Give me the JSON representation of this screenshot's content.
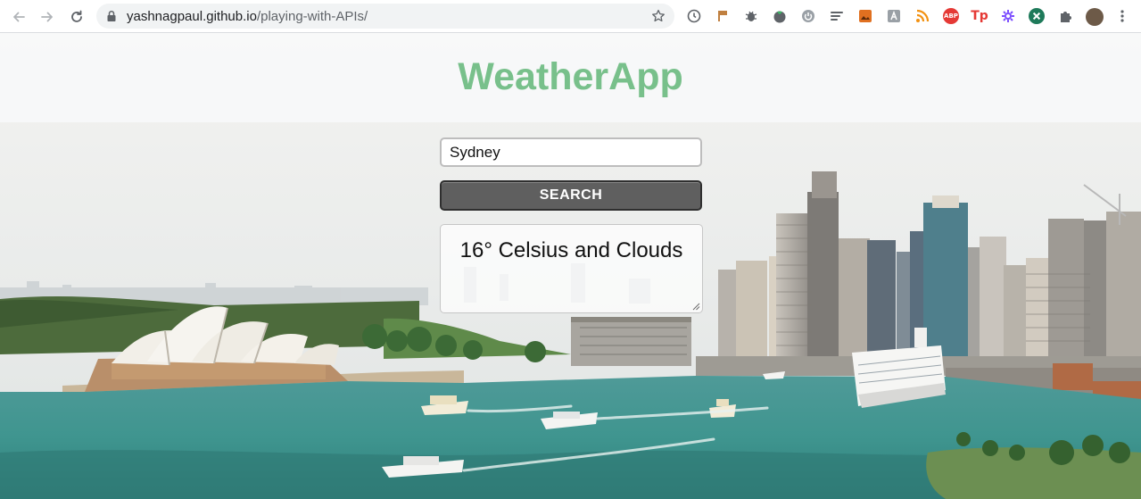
{
  "browser": {
    "url_host": "yashnagpaul.github.io",
    "url_path": "/playing-with-APIs/",
    "extensions": [
      {
        "icon": "timer-icon",
        "color": "#5f6368"
      },
      {
        "icon": "flag-icon",
        "color": "#c08040"
      },
      {
        "icon": "bug-icon",
        "color": "#5f6368"
      },
      {
        "icon": "tomato-icon",
        "color": "#5f6368"
      },
      {
        "icon": "power-icon",
        "color": "#9aa0a6"
      },
      {
        "icon": "list-icon",
        "color": "#5f6368"
      },
      {
        "icon": "picture-icon",
        "color": "#e07020"
      },
      {
        "icon": "translate-icon",
        "color": "#9aa0a6"
      },
      {
        "icon": "rss-icon",
        "color": "#f29111"
      },
      {
        "icon": "adblock-icon",
        "color": "#e53935",
        "label": "ABP"
      },
      {
        "icon": "tp-icon",
        "color": "#e53935",
        "label": "Tp"
      },
      {
        "icon": "gear-flower-icon",
        "color": "#7c4dff"
      },
      {
        "icon": "x-icon",
        "color": "#1e7a5a"
      },
      {
        "icon": "puzzle-icon",
        "color": "#5f6368"
      },
      {
        "icon": "profile-avatar",
        "color": "#6d5a48"
      },
      {
        "icon": "menu-dots-icon",
        "color": "#5f6368"
      }
    ]
  },
  "app": {
    "title": "WeatherApp",
    "search_value": "Sydney",
    "search_button": "SEARCH",
    "result": "16° Celsius and Clouds"
  },
  "colors": {
    "title": "#78c08b",
    "button": "#5f5f5f",
    "water": "#3f9aa0"
  }
}
